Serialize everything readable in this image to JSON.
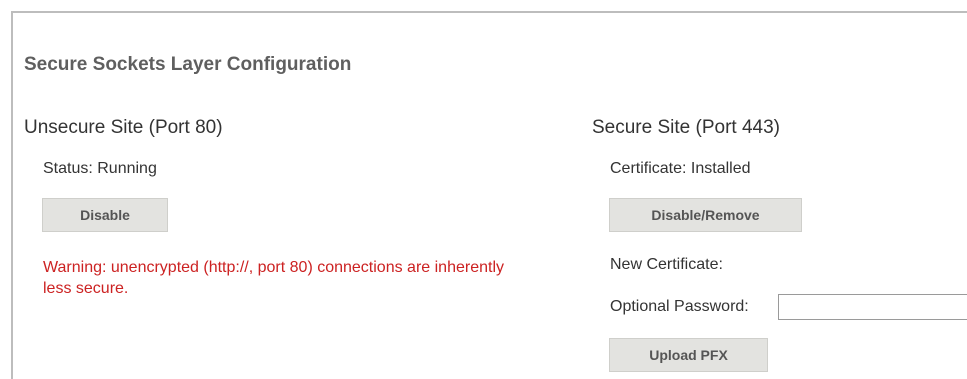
{
  "section": {
    "title": "Secure Sockets Layer Configuration"
  },
  "unsecure": {
    "heading": "Unsecure Site (Port 80)",
    "status": "Status: Running",
    "disable_label": "Disable",
    "warning": "Warning: unencrypted (http://, port 80) connections are inherently less secure."
  },
  "secure": {
    "heading": "Secure Site (Port 443)",
    "certificate": "Certificate: Installed",
    "disable_remove_label": "Disable/Remove",
    "new_certificate": "New Certificate:",
    "password_label": "Optional Password:",
    "password_value": "",
    "upload_label": "Upload PFX"
  },
  "colors": {
    "warning": "#cc2222",
    "button_bg": "#e3e3e0",
    "title": "#5f5f5f"
  }
}
